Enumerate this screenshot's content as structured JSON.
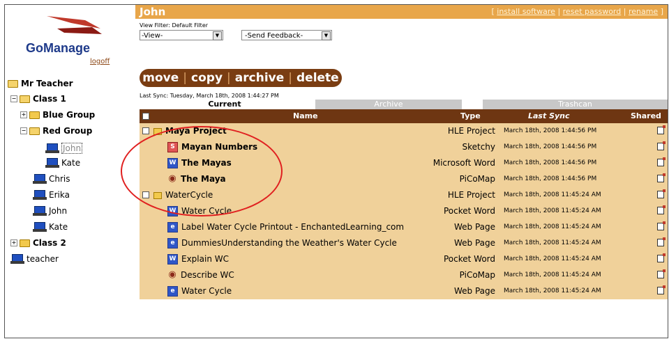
{
  "sidebar": {
    "brand": "GoManage",
    "logoff": "logoff",
    "tree": [
      {
        "label": "Mr Teacher",
        "kind": "folder",
        "level": 0
      },
      {
        "label": "Class 1",
        "kind": "folder",
        "level": 1,
        "expand": "−"
      },
      {
        "label": "Blue Group",
        "kind": "folder",
        "level": 2,
        "expand": "+"
      },
      {
        "label": "Red Group",
        "kind": "folder",
        "level": 2,
        "expand": "−"
      },
      {
        "label": "John",
        "kind": "device",
        "level": 3,
        "selected": true
      },
      {
        "label": "Kate",
        "kind": "device",
        "level": 3
      },
      {
        "label": "Chris",
        "kind": "device",
        "level": 2
      },
      {
        "label": "Erika",
        "kind": "device",
        "level": 2
      },
      {
        "label": "John",
        "kind": "device",
        "level": 2
      },
      {
        "label": "Kate",
        "kind": "device",
        "level": 2
      },
      {
        "label": "Class 2",
        "kind": "folder",
        "level": 1,
        "expand": "+"
      },
      {
        "label": "teacher",
        "kind": "device",
        "level": 0
      }
    ]
  },
  "header": {
    "user": "John",
    "links_open": "[ ",
    "link1": "install software",
    "link2": "reset password",
    "link3": "rename",
    "sep": " | ",
    "links_close": " ]"
  },
  "filters": {
    "label": "View Filter: Default Filter",
    "view": "-View-",
    "feedback": "-Send Feedback-"
  },
  "actions": {
    "move": "move",
    "copy": "copy",
    "archive": "archive",
    "delete": "delete",
    "separator": "|"
  },
  "last_sync": "Last Sync: Tuesday, March 18th, 2008 1:44:27 PM",
  "tabs": {
    "current": "Current",
    "archive": "Archive",
    "trashcan": "Trashcan"
  },
  "table": {
    "columns": {
      "name": "Name",
      "type": "Type",
      "sync": "Last Sync",
      "shared": "Shared"
    },
    "rows": [
      {
        "name": "Maya Project",
        "type": "HLE Project",
        "sync": "March 18th, 2008 1:44:56 PM",
        "icon": "project-folder-icon",
        "indent": 0,
        "bold": true,
        "checkbox": true
      },
      {
        "name": "Mayan Numbers",
        "type": "Sketchy",
        "sync": "March 18th, 2008 1:44:56 PM",
        "icon": "sketchy-icon",
        "indent": 1,
        "bold": true
      },
      {
        "name": "The Mayas",
        "type": "Microsoft Word",
        "sync": "March 18th, 2008 1:44:56 PM",
        "icon": "word-doc-icon",
        "indent": 1,
        "bold": true
      },
      {
        "name": "The Maya",
        "type": "PiCoMap",
        "sync": "March 18th, 2008 1:44:56 PM",
        "icon": "picomap-icon",
        "indent": 1,
        "bold": true
      },
      {
        "name": "WaterCycle",
        "type": "HLE Project",
        "sync": "March 18th, 2008 11:45:24 AM",
        "icon": "project-folder-icon",
        "indent": 0,
        "bold": false,
        "checkbox": true
      },
      {
        "name": "Water Cycle",
        "type": "Pocket Word",
        "sync": "March 18th, 2008 11:45:24 AM",
        "icon": "word-doc-icon",
        "indent": 1,
        "bold": false
      },
      {
        "name": "Label Water Cycle Printout - EnchantedLearning_com",
        "type": "Web Page",
        "sync": "March 18th, 2008 11:45:24 AM",
        "icon": "web-page-icon",
        "indent": 1,
        "bold": false
      },
      {
        "name": "DummiesUnderstanding the Weather's Water Cycle",
        "type": "Web Page",
        "sync": "March 18th, 2008 11:45:24 AM",
        "icon": "web-page-icon",
        "indent": 1,
        "bold": false
      },
      {
        "name": "Explain WC",
        "type": "Pocket Word",
        "sync": "March 18th, 2008 11:45:24 AM",
        "icon": "word-doc-icon",
        "indent": 1,
        "bold": false
      },
      {
        "name": "Describe WC",
        "type": "PiCoMap",
        "sync": "March 18th, 2008 11:45:24 AM",
        "icon": "picomap-icon",
        "indent": 1,
        "bold": false
      },
      {
        "name": "Water Cycle",
        "type": "Web Page",
        "sync": "March 18th, 2008 11:45:24 AM",
        "icon": "web-page-icon",
        "indent": 1,
        "bold": false
      }
    ]
  },
  "colors": {
    "accent": "#e8a64a",
    "header_dark": "#6e3612",
    "row_bg": "#f0d19a",
    "highlight": "#e02020"
  }
}
